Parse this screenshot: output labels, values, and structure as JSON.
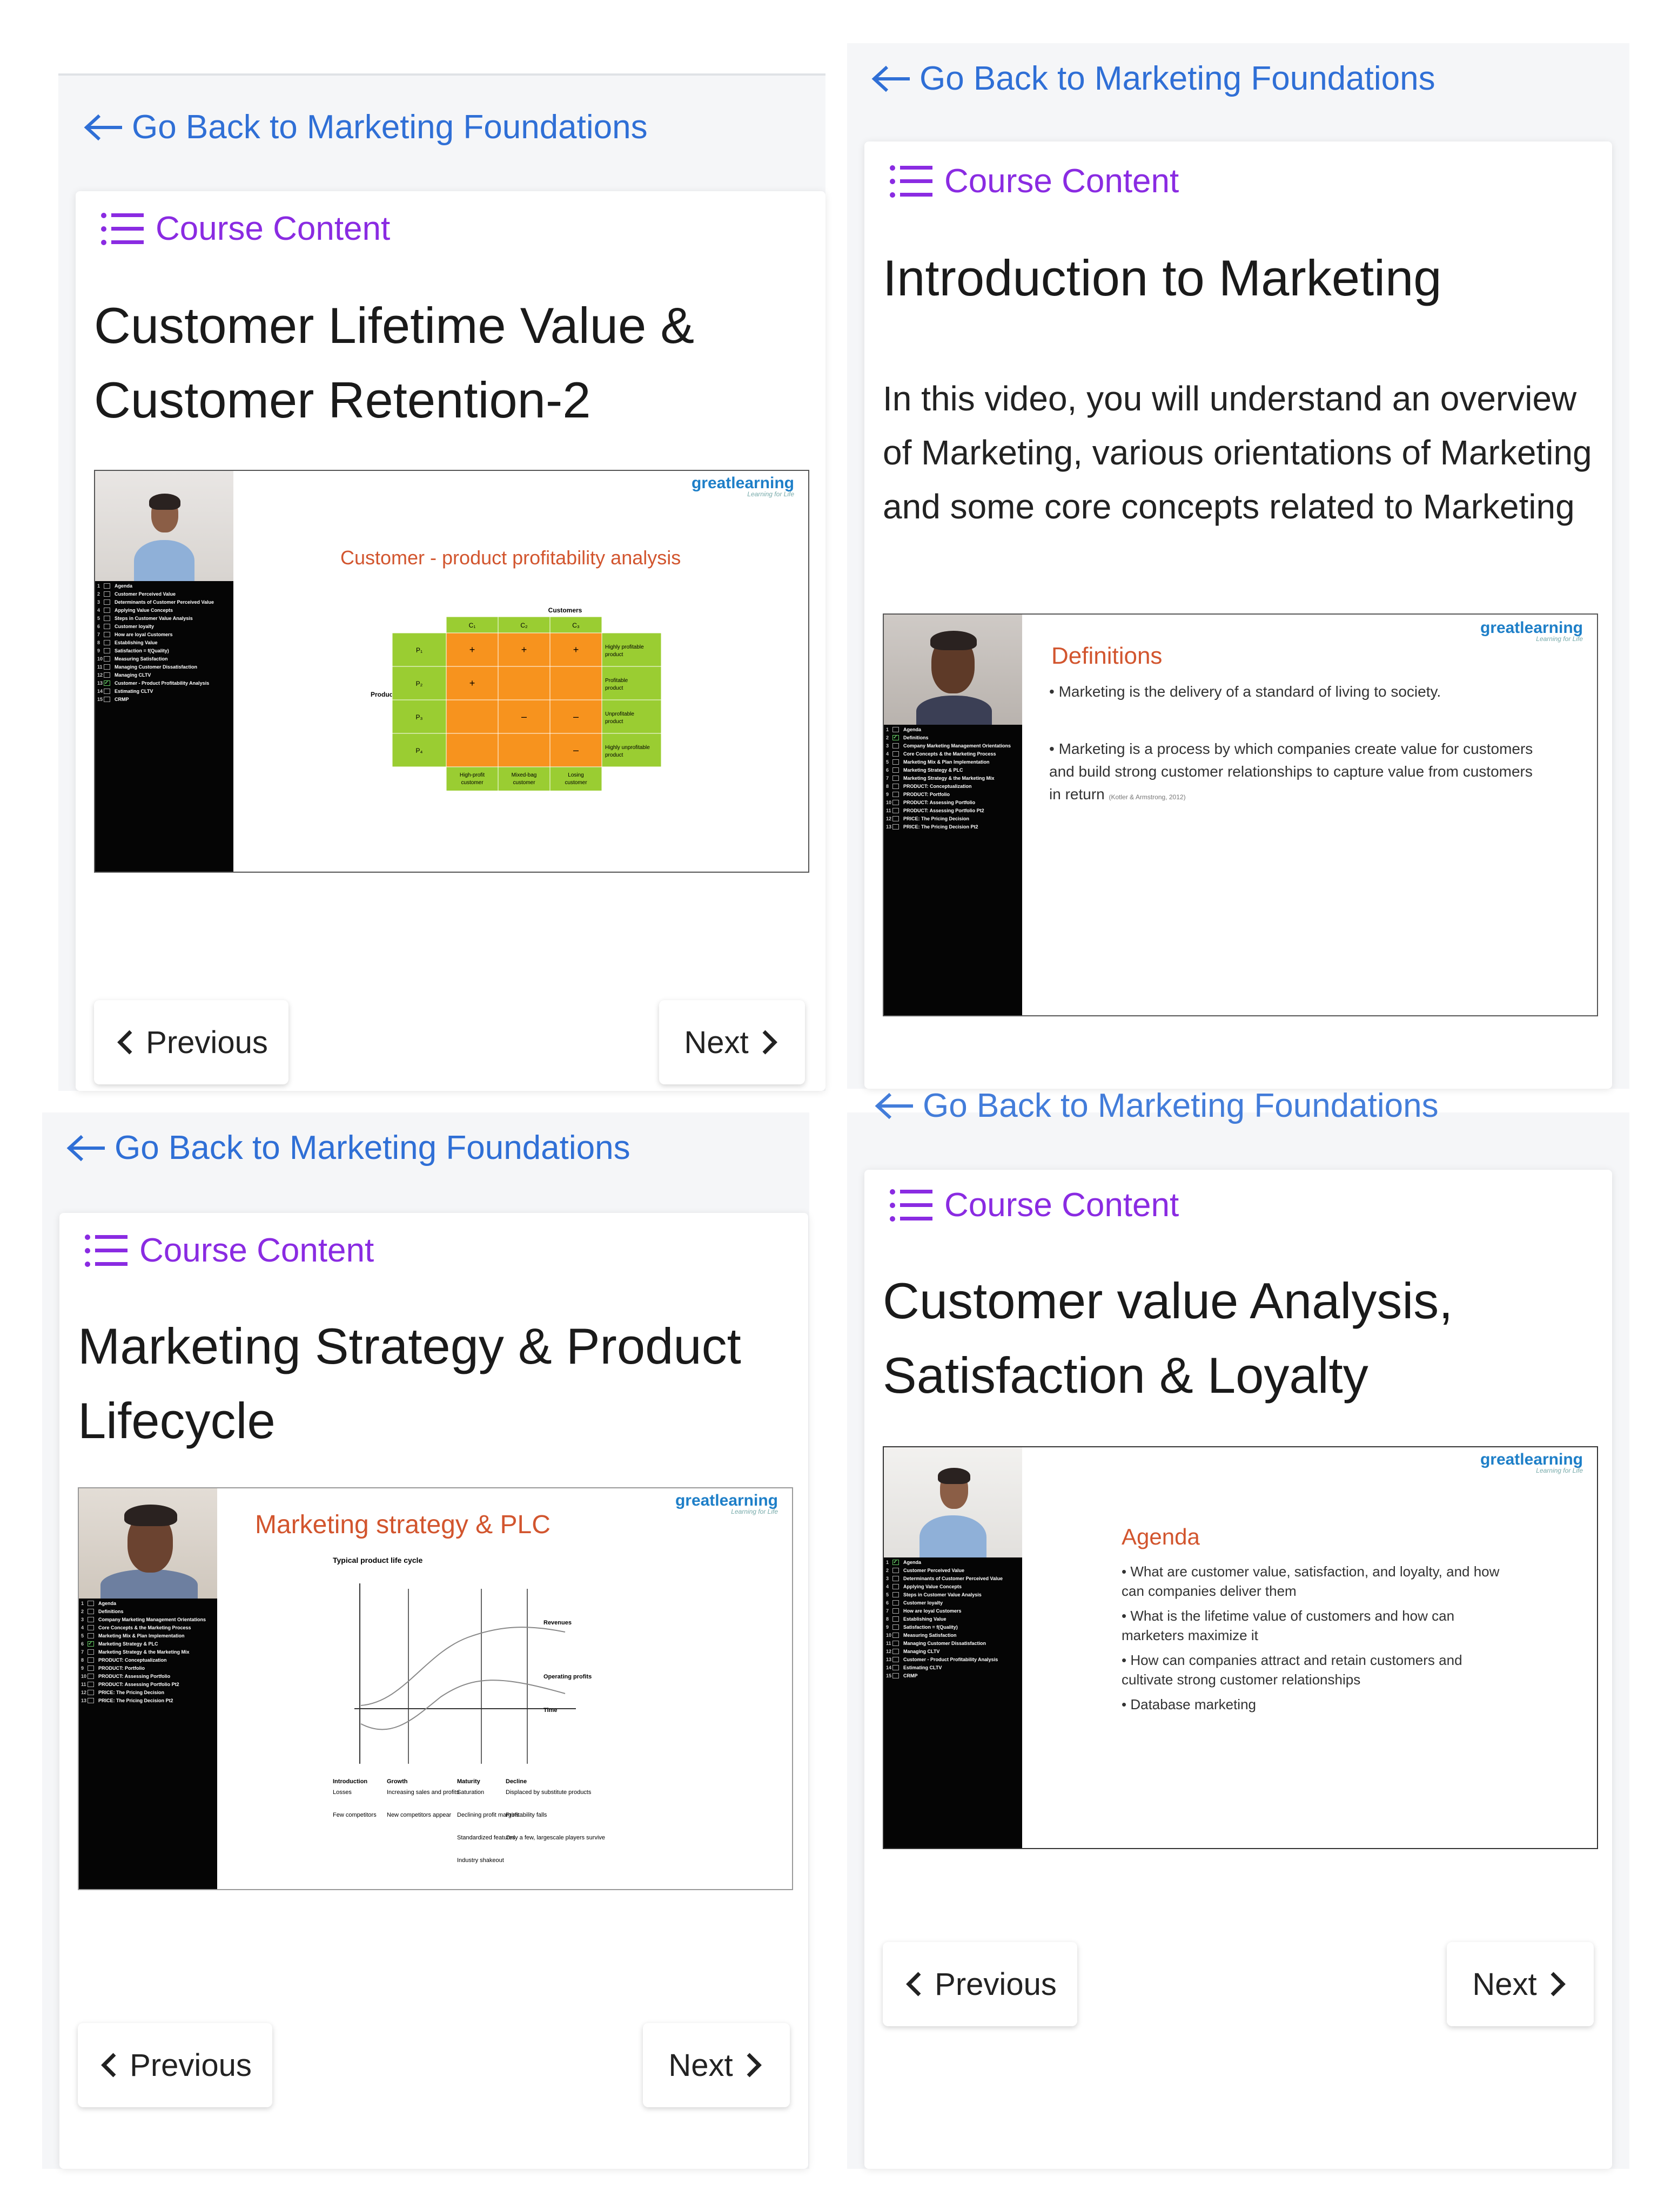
{
  "common": {
    "back_label": "Go Back to Marketing Foundations",
    "course_content_label": "Course Content",
    "previous_label": "Previous",
    "next_label": "Next",
    "brand_name": "greatlearning",
    "brand_tagline": "Learning for Life",
    "colors": {
      "link": "#2f6fd6",
      "course_content": "#8a2be2",
      "slide_title": "#d2552e",
      "toc_bg": "#050505"
    }
  },
  "panels": [
    {
      "title": "Customer Lifetime Value & Customer Retention-2",
      "video": {
        "slide_title": "Customer - product profitability analysis",
        "matrix": {
          "columns_header": "Customers",
          "columns": [
            "C₁",
            "C₂",
            "C₃"
          ],
          "rows_header": "Products",
          "rows": [
            "P₁",
            "P₂",
            "P₃",
            "P₄"
          ],
          "cells": [
            [
              "+",
              "+",
              "+"
            ],
            [
              "+",
              "",
              ""
            ],
            [
              "",
              "–",
              "–"
            ],
            [
              "",
              "",
              "–"
            ]
          ],
          "row_labels": [
            "Highly profitable product",
            "Profitable product",
            "Unprofitable product",
            "Highly unprofitable product"
          ],
          "col_labels": [
            "High-profit customer",
            "Mixed-bag customer",
            "Losing customer"
          ]
        },
        "toc": [
          {
            "n": "1",
            "label": "Agenda"
          },
          {
            "n": "2",
            "label": "Customer Perceived Value"
          },
          {
            "n": "3",
            "label": "Determinants of Customer Perceived Value"
          },
          {
            "n": "4",
            "label": "Applying Value Concepts"
          },
          {
            "n": "5",
            "label": "Steps in Customer Value Analysis"
          },
          {
            "n": "6",
            "label": "Customer loyalty"
          },
          {
            "n": "7",
            "label": "How are loyal Customers"
          },
          {
            "n": "8",
            "label": "Establishing Value"
          },
          {
            "n": "9",
            "label": "Satisfaction = f(Quality)"
          },
          {
            "n": "10",
            "label": "Measuring Satisfaction"
          },
          {
            "n": "11",
            "label": "Managing Customer Dissatisfaction"
          },
          {
            "n": "12",
            "label": "Managing CLTV"
          },
          {
            "n": "13",
            "label": "Customer - Product Profitability Analysis",
            "checked": true
          },
          {
            "n": "14",
            "label": "Estimating CLTV"
          },
          {
            "n": "15",
            "label": "CRMP"
          }
        ]
      }
    },
    {
      "title": "Introduction to Marketing",
      "description": "In this video, you will understand an overview of Marketing, various orientations of Marketing and some core concepts related to Marketing",
      "video": {
        "slide_title": "Definitions",
        "bullets": [
          "Marketing is the delivery of a standard of living to society.",
          "Marketing is a process by which companies create value for customers and build strong customer relationships to capture value from customers in return"
        ],
        "citation": "(Kotler & Armstrong, 2012)",
        "toc": [
          {
            "n": "1",
            "label": "Agenda"
          },
          {
            "n": "2",
            "label": "Definitions",
            "checked": true
          },
          {
            "n": "3",
            "label": "Company Marketing Management Orientations"
          },
          {
            "n": "4",
            "label": "Core Concepts & the Marketing Process"
          },
          {
            "n": "5",
            "label": "Marketing Mix & Plan Implementation"
          },
          {
            "n": "6",
            "label": "Marketing Strategy & PLC"
          },
          {
            "n": "7",
            "label": "Marketing Strategy & the Marketing Mix"
          },
          {
            "n": "8",
            "label": "PRODUCT: Conceptualization"
          },
          {
            "n": "9",
            "label": "PRODUCT: Portfolio"
          },
          {
            "n": "10",
            "label": "PRODUCT: Assessing Portfolio"
          },
          {
            "n": "11",
            "label": "PRODUCT: Assessing Portfolio Pt2"
          },
          {
            "n": "12",
            "label": "PRICE: The Pricing Decision"
          },
          {
            "n": "13",
            "label": "PRICE: The Pricing Decision Pt2"
          }
        ]
      }
    },
    {
      "title": "Marketing Strategy & Product Lifecycle",
      "video": {
        "slide_title": "Marketing strategy & PLC",
        "chart_heading": "Typical product life cycle",
        "curve_labels": [
          "Revenues",
          "Operating profits",
          "Time"
        ],
        "stages": [
          "Introduction",
          "Growth",
          "Maturity",
          "Decline"
        ],
        "row1": [
          "Losses",
          "Increasing sales and profits",
          "Saturation",
          "Displaced by substitute products"
        ],
        "row2": [
          "Few competitors",
          "New competitors appear",
          "Declining profit margins",
          "Profitability falls"
        ],
        "row3": [
          "",
          "",
          "Standardized features",
          "Only a few, largescale players survive"
        ],
        "row4": [
          "",
          "",
          "Industry shakeout",
          ""
        ],
        "toc": [
          {
            "n": "1",
            "label": "Agenda"
          },
          {
            "n": "2",
            "label": "Definitions"
          },
          {
            "n": "3",
            "label": "Company Marketing Management Orientations"
          },
          {
            "n": "4",
            "label": "Core Concepts & the Marketing Process"
          },
          {
            "n": "5",
            "label": "Marketing Mix & Plan Implementation"
          },
          {
            "n": "6",
            "label": "Marketing Strategy & PLC",
            "checked": true
          },
          {
            "n": "7",
            "label": "Marketing Strategy & the Marketing Mix"
          },
          {
            "n": "8",
            "label": "PRODUCT: Conceptualization"
          },
          {
            "n": "9",
            "label": "PRODUCT: Portfolio"
          },
          {
            "n": "10",
            "label": "PRODUCT: Assessing Portfolio"
          },
          {
            "n": "11",
            "label": "PRODUCT: Assessing Portfolio Pt2"
          },
          {
            "n": "12",
            "label": "PRICE: The Pricing Decision"
          },
          {
            "n": "13",
            "label": "PRICE: The Pricing Decision Pt2"
          }
        ]
      }
    },
    {
      "title": "Customer value Analysis, Satisfaction & Loyalty",
      "video": {
        "slide_title": "Agenda",
        "bullets": [
          "What are customer value, satisfaction, and loyalty, and how can companies deliver them",
          "What is the lifetime value of customers and how can marketers maximize it",
          "How can companies attract and retain customers and cultivate strong customer relationships",
          "Database marketing"
        ],
        "toc": [
          {
            "n": "1",
            "label": "Agenda",
            "checked": true
          },
          {
            "n": "2",
            "label": "Customer Perceived Value"
          },
          {
            "n": "3",
            "label": "Determinants of Customer Perceived Value"
          },
          {
            "n": "4",
            "label": "Applying Value Concepts"
          },
          {
            "n": "5",
            "label": "Steps in Customer Value Analysis"
          },
          {
            "n": "6",
            "label": "Customer loyalty"
          },
          {
            "n": "7",
            "label": "How are loyal Customers"
          },
          {
            "n": "8",
            "label": "Establishing Value"
          },
          {
            "n": "9",
            "label": "Satisfaction = f(Quality)"
          },
          {
            "n": "10",
            "label": "Measuring Satisfaction"
          },
          {
            "n": "11",
            "label": "Managing Customer Dissatisfaction"
          },
          {
            "n": "12",
            "label": "Managing CLTV"
          },
          {
            "n": "13",
            "label": "Customer - Product Profitability Analysis"
          },
          {
            "n": "14",
            "label": "Estimating CLTV"
          },
          {
            "n": "15",
            "label": "CRMP"
          }
        ]
      }
    }
  ]
}
